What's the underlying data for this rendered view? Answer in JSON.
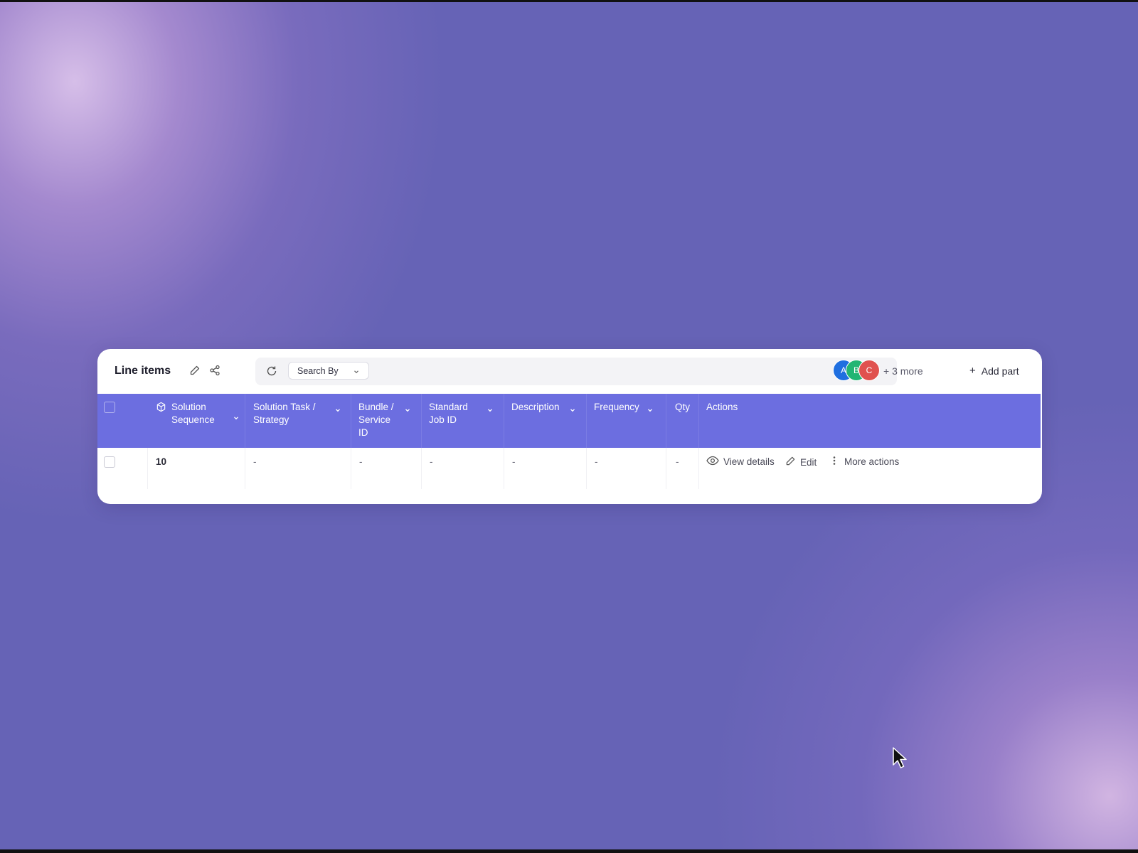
{
  "toolbar": {
    "title": "Line items",
    "search_by_label": "Search By",
    "more_collaborators": "+ 3 more",
    "add_part_label": "Add part",
    "avatars": [
      {
        "initial": "A",
        "color": "#1f6fe0"
      },
      {
        "initial": "B",
        "color": "#22b573"
      },
      {
        "initial": "C",
        "color": "#e0524f"
      }
    ]
  },
  "table": {
    "columns": [
      {
        "label": "Solution Sequence"
      },
      {
        "label": "Solution Task / Strategy"
      },
      {
        "label": "Bundle / Service ID"
      },
      {
        "label": "Standard Job ID"
      },
      {
        "label": "Description"
      },
      {
        "label": "Frequency"
      },
      {
        "label": "Qty"
      },
      {
        "label": "Actions"
      }
    ],
    "rows": [
      {
        "solution_sequence": "10",
        "solution_task": "-",
        "bundle_service_id": "-",
        "standard_job_id": "-",
        "description": "-",
        "frequency": "-",
        "qty": "-"
      }
    ],
    "row_actions": {
      "view": "View details",
      "edit": "Edit",
      "more": "More actions"
    }
  },
  "colors": {
    "header_bg": "#6c6ee0",
    "page_bg": "#6663b6"
  }
}
